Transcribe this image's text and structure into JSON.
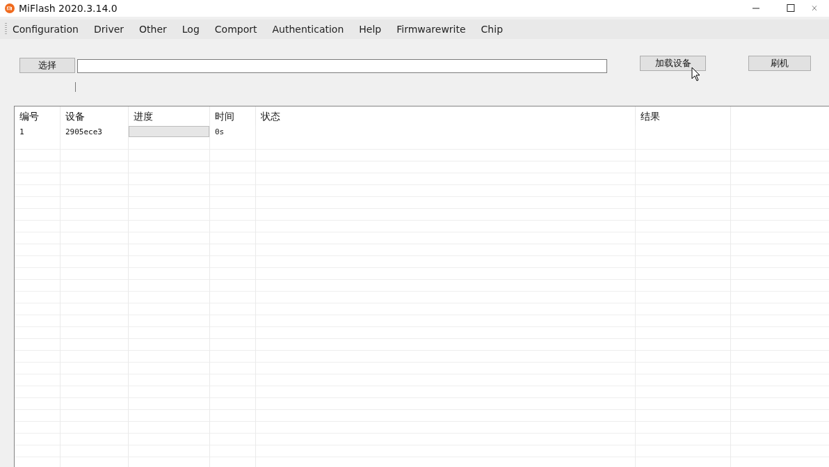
{
  "window": {
    "title": "MiFlash 2020.3.14.0"
  },
  "menu": [
    "Configuration",
    "Driver",
    "Other",
    "Log",
    "Comport",
    "Authentication",
    "Help",
    "Firmwarewrite",
    "Chip"
  ],
  "toolbar": {
    "select_button": "选择",
    "load_button": "加载设备",
    "flash_button": "刷机"
  },
  "table": {
    "columns": [
      "编号",
      "设备",
      "进度",
      "时间",
      "状态",
      "结果"
    ],
    "rows": [
      {
        "cells": [
          "1",
          "2905ece3"
        ],
        "level": 0,
        "time": "0s"
      }
    ]
  }
}
